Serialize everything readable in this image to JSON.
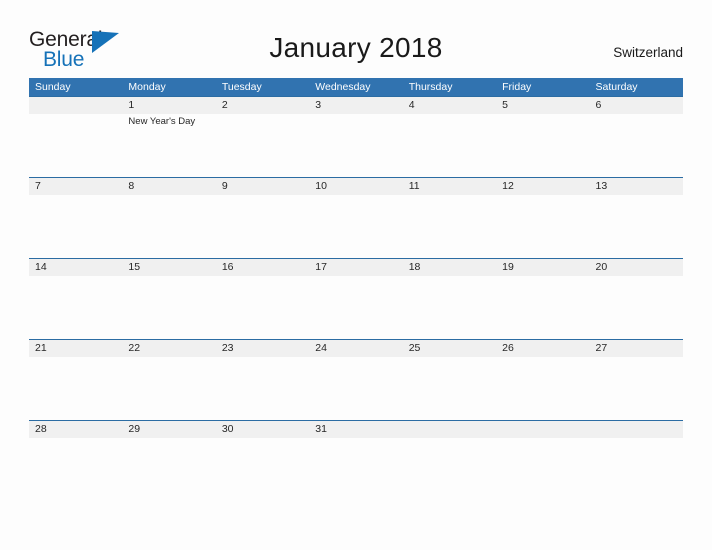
{
  "brand": {
    "logo_text_top": "General",
    "logo_text_bottom": "Blue",
    "logo_flag_color": "#1672b8",
    "logo_text_top_color": "#231f20",
    "logo_text_bottom_color": "#1672b8"
  },
  "header": {
    "title": "January 2018",
    "country": "Switzerland"
  },
  "theme": {
    "header_blue": "#3173b0",
    "week_divider_blue": "#2b6ca3",
    "date_strip_gray": "#f0f0f0",
    "page_background": "#fdfdfd",
    "text_color": "#262626"
  },
  "calendar": {
    "month": "January",
    "year": "2018",
    "weekday_headers": [
      "Sunday",
      "Monday",
      "Tuesday",
      "Wednesday",
      "Thursday",
      "Friday",
      "Saturday"
    ],
    "weeks": [
      {
        "days": [
          {
            "num": "",
            "events": []
          },
          {
            "num": "1",
            "events": [
              "New Year's Day"
            ]
          },
          {
            "num": "2",
            "events": []
          },
          {
            "num": "3",
            "events": []
          },
          {
            "num": "4",
            "events": []
          },
          {
            "num": "5",
            "events": []
          },
          {
            "num": "6",
            "events": []
          }
        ]
      },
      {
        "days": [
          {
            "num": "7",
            "events": []
          },
          {
            "num": "8",
            "events": []
          },
          {
            "num": "9",
            "events": []
          },
          {
            "num": "10",
            "events": []
          },
          {
            "num": "11",
            "events": []
          },
          {
            "num": "12",
            "events": []
          },
          {
            "num": "13",
            "events": []
          }
        ]
      },
      {
        "days": [
          {
            "num": "14",
            "events": []
          },
          {
            "num": "15",
            "events": []
          },
          {
            "num": "16",
            "events": []
          },
          {
            "num": "17",
            "events": []
          },
          {
            "num": "18",
            "events": []
          },
          {
            "num": "19",
            "events": []
          },
          {
            "num": "20",
            "events": []
          }
        ]
      },
      {
        "days": [
          {
            "num": "21",
            "events": []
          },
          {
            "num": "22",
            "events": []
          },
          {
            "num": "23",
            "events": []
          },
          {
            "num": "24",
            "events": []
          },
          {
            "num": "25",
            "events": []
          },
          {
            "num": "26",
            "events": []
          },
          {
            "num": "27",
            "events": []
          }
        ]
      },
      {
        "days": [
          {
            "num": "28",
            "events": []
          },
          {
            "num": "29",
            "events": []
          },
          {
            "num": "30",
            "events": []
          },
          {
            "num": "31",
            "events": []
          },
          {
            "num": "",
            "events": []
          },
          {
            "num": "",
            "events": []
          },
          {
            "num": "",
            "events": []
          }
        ]
      }
    ]
  }
}
